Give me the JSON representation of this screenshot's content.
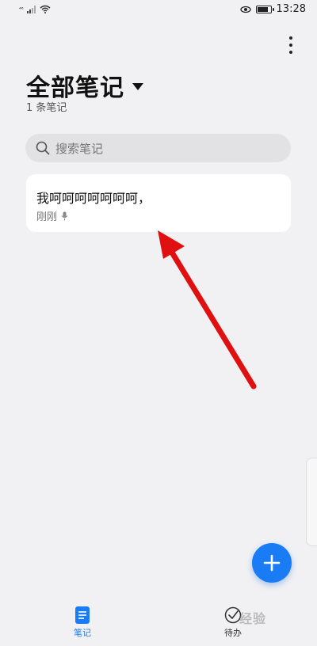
{
  "status_bar": {
    "network": "⁴⁶",
    "time": "13:28",
    "battery_level": 0.85
  },
  "header": {
    "title": "全部笔记",
    "count": "1 条笔记"
  },
  "search": {
    "placeholder": "搜索笔记"
  },
  "notes": [
    {
      "title": "我呵呵呵呵呵呵呵，",
      "time": "刚刚",
      "has_voice": true
    }
  ],
  "fab": {
    "icon": "plus-icon"
  },
  "bottom_nav": {
    "items": [
      {
        "label": "笔记",
        "icon": "note-icon",
        "active": true
      },
      {
        "label": "待办",
        "icon": "todo-check-icon",
        "active": false
      }
    ]
  },
  "watermark": "经验",
  "colors": {
    "accent": "#1a7cf5",
    "background": "#f1f1f3",
    "annotation_arrow": "#e01010"
  }
}
